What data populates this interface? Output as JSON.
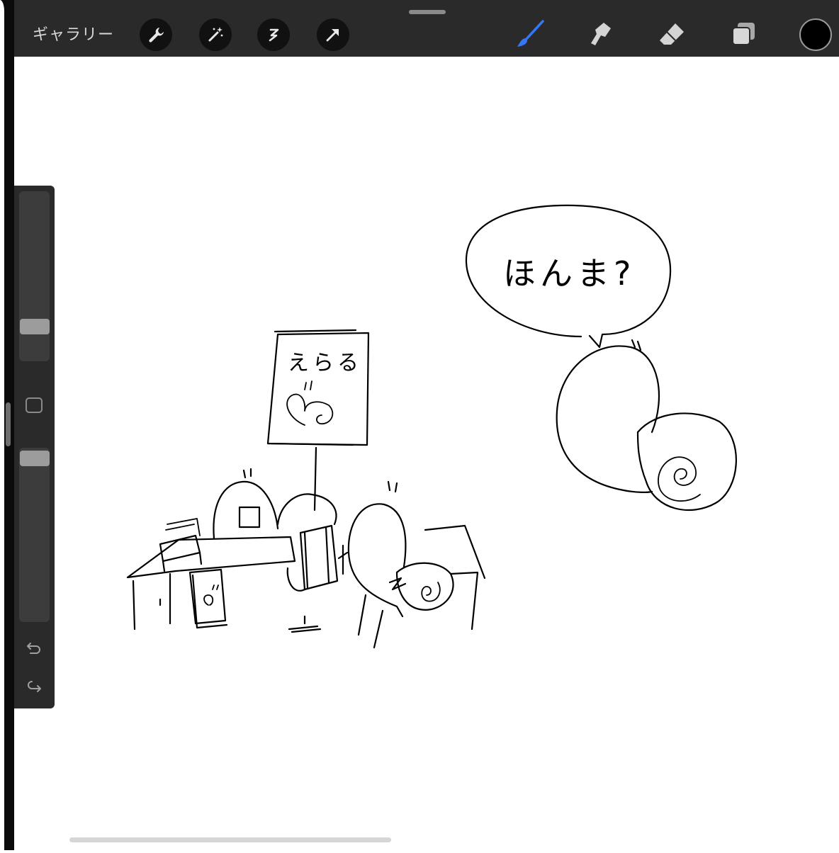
{
  "toolbar": {
    "gallery_label": "ギャラリー",
    "left_tools": [
      "wrench-icon",
      "magic-wand-icon",
      "selection-icon",
      "transform-arrow-icon"
    ],
    "right_tools": [
      "brush-icon",
      "smudge-icon",
      "eraser-icon",
      "layers-icon"
    ],
    "active_tool": "brush-icon",
    "current_color": "#000000",
    "accent_color": "#3478f6"
  },
  "sidebar": {
    "brush_size_level": 0.22,
    "opacity_level": 0.9,
    "undo_icon": "undo-icon",
    "redo_icon": "redo-icon"
  },
  "drawing": {
    "speech_bubble_text": "ほんま?",
    "sign_text": "えらる"
  }
}
